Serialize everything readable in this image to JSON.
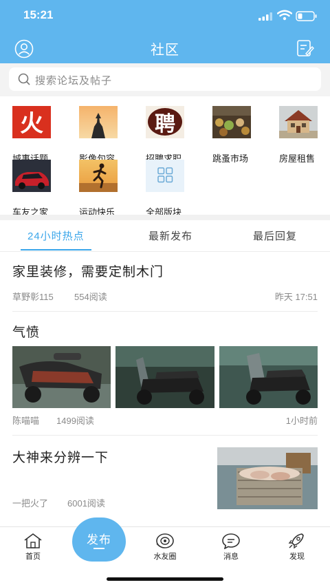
{
  "status_bar": {
    "time": "15:21"
  },
  "header": {
    "title": "社区"
  },
  "search": {
    "placeholder": "搜索论坛及帖子"
  },
  "categories": [
    {
      "label": "城事话题",
      "icon": "fire-character-icon",
      "glyph": "火",
      "color": "#d9301e"
    },
    {
      "label": "影像句容",
      "icon": "pagoda-sunset-image"
    },
    {
      "label": "招聘求职",
      "icon": "recruit-character-icon",
      "glyph": "聘",
      "color": "#c8162a"
    },
    {
      "label": "跳蚤市场",
      "icon": "market-stall-image"
    },
    {
      "label": "房屋租售",
      "icon": "house-image"
    },
    {
      "label": "车友之家",
      "icon": "red-car-image"
    },
    {
      "label": "运动快乐",
      "icon": "runner-image"
    },
    {
      "label": "全部版块",
      "icon": "grid-icon"
    }
  ],
  "tabs": [
    {
      "label": "24小时热点",
      "active": true
    },
    {
      "label": "最新发布",
      "active": false
    },
    {
      "label": "最后回复",
      "active": false
    }
  ],
  "posts": [
    {
      "title": "家里装修，需要定制木门",
      "author": "草野彰115",
      "reads": "554阅读",
      "time": "昨天 17:51"
    },
    {
      "title": "气愤",
      "author": "陈喵喵",
      "reads": "1499阅读",
      "time": "1小时前",
      "images": [
        "scooter-photo-1",
        "scooter-photo-2",
        "scooter-photo-3"
      ]
    },
    {
      "title": "大神来分辨一下",
      "author": "一把火了",
      "reads": "6001阅读",
      "images": [
        "basket-photo"
      ]
    }
  ],
  "bottom_nav": [
    {
      "label": "首页",
      "icon": "home-icon"
    },
    {
      "label": "发布",
      "icon": "publish-fab"
    },
    {
      "label": "水友圈",
      "icon": "circle-eye-icon"
    },
    {
      "label": "消息",
      "icon": "message-icon"
    },
    {
      "label": "发现",
      "icon": "rocket-icon"
    }
  ],
  "colors": {
    "accent": "#5fb6ee",
    "tab_active": "#3aa6ea"
  }
}
